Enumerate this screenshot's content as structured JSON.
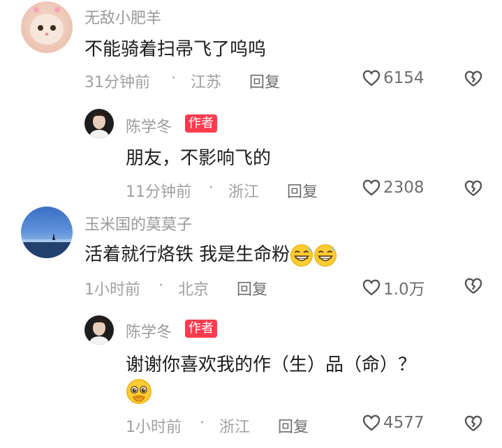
{
  "comments": [
    {
      "username": "无敌小肥羊",
      "text": "不能骑着扫帚飞了呜呜",
      "time": "31分钟前",
      "location": "江苏",
      "reply_label": "回复",
      "likes": "6154",
      "avatar_icon": "kitten-avatar"
    },
    {
      "username": "陈学冬",
      "author_badge": "作者",
      "text": "朋友，不影响飞的",
      "time": "11分钟前",
      "location": "浙江",
      "reply_label": "回复",
      "likes": "2308",
      "avatar_icon": "man-avatar"
    },
    {
      "username": "玉米国的莫莫子",
      "text": "活着就行烙铁 我是生命粉",
      "time": "1小时前",
      "location": "北京",
      "reply_label": "回复",
      "likes": "1.0万",
      "avatar_icon": "blue-sky-avatar",
      "emojis": [
        "grinning-sweat-emoji",
        "grinning-sweat-emoji"
      ]
    },
    {
      "username": "陈学冬",
      "author_badge": "作者",
      "text": "谢谢你喜欢我的作（生）品（命）？",
      "time": "1小时前",
      "location": "浙江",
      "reply_label": "回复",
      "likes": "4577",
      "avatar_icon": "man-avatar",
      "emojis": [
        "pleading-face-emoji"
      ]
    }
  ],
  "separator": "·",
  "colors": {
    "badge": "#ff3b4f",
    "meta": "#a0a0a0",
    "username": "#9a9a9a"
  }
}
